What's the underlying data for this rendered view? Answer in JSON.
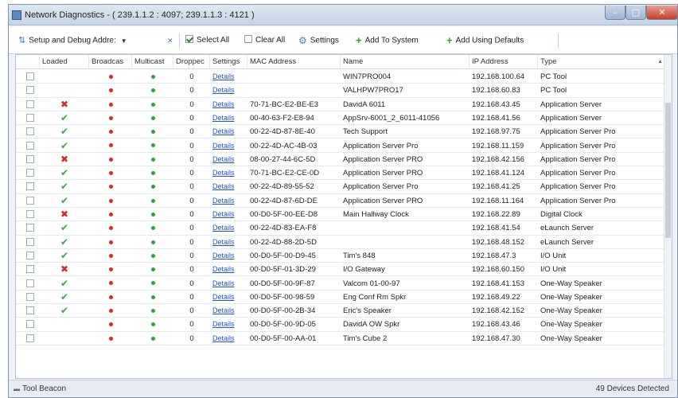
{
  "window": {
    "title": "Network Diagnostics - ( 239.1.1.2 : 4097; 239.1.1.3 : 4121 )",
    "minimize_glyph": "–",
    "maximize_glyph": "□",
    "close_glyph": "✕"
  },
  "toolbar": {
    "setup_label": "Setup and Debug Addre:",
    "select_all_label": "Select All",
    "clear_all_label": "Clear All",
    "settings_label": "Settings",
    "add_to_system_label": "Add To System",
    "add_using_defaults_label": "Add Using Defaults"
  },
  "columns": {
    "loaded": "Loaded",
    "broadcast": "Broadcas",
    "multicast": "Multicast",
    "dropped": "Droppec",
    "settings": "Settings",
    "mac": "MAC Address",
    "name": "Name",
    "ip": "IP Address",
    "type": "Type"
  },
  "colors": {
    "error": "#d22b2b",
    "ok": "#3aa83a",
    "broadcast_dot": "#e02828",
    "multicast_dot": "#29a832",
    "link": "#2255cc"
  },
  "rows": [
    {
      "loaded": "",
      "dropped": "0",
      "settings": "Details",
      "mac": "",
      "name": "WIN7PRO004",
      "ip": "192.168.100.64",
      "type": "PC Tool"
    },
    {
      "loaded": "",
      "dropped": "0",
      "settings": "Details",
      "mac": "",
      "name": "VALHPW7PRO17",
      "ip": "192.168.60.83",
      "type": "PC Tool"
    },
    {
      "loaded": "x",
      "dropped": "0",
      "settings": "Details",
      "mac": "70-71-BC-E2-BE-E3",
      "name": "DavidA 6011",
      "ip": "192.168.43.45",
      "type": "Application Server"
    },
    {
      "loaded": "ok",
      "dropped": "0",
      "settings": "Details",
      "mac": "00-40-63-F2-E8-94",
      "name": "AppSrv-6001_2_6011-41056",
      "ip": "192.168.41.56",
      "type": "Application Server"
    },
    {
      "loaded": "ok",
      "dropped": "0",
      "settings": "Details",
      "mac": "00-22-4D-87-8E-40",
      "name": "Tech Support",
      "ip": "192.168.97.75",
      "type": "Application Server Pro"
    },
    {
      "loaded": "ok",
      "dropped": "0",
      "settings": "Details",
      "mac": "00-22-4D-AC-4B-03",
      "name": "Application Server Pro",
      "ip": "192.168.11.159",
      "type": "Application Server Pro"
    },
    {
      "loaded": "x",
      "dropped": "0",
      "settings": "Details",
      "mac": "08-00-27-44-6C-5D",
      "name": "Application Server PRO",
      "ip": "192.168.42.156",
      "type": "Application Server Pro"
    },
    {
      "loaded": "ok",
      "dropped": "0",
      "settings": "Details",
      "mac": "70-71-BC-E2-CE-0D",
      "name": "Application Server PRO",
      "ip": "192.168.41.124",
      "type": "Application Server Pro"
    },
    {
      "loaded": "ok",
      "dropped": "0",
      "settings": "Details",
      "mac": "00-22-4D-89-55-52",
      "name": "Application Server Pro",
      "ip": "192.168.41.25",
      "type": "Application Server Pro"
    },
    {
      "loaded": "ok",
      "dropped": "0",
      "settings": "Details",
      "mac": "00-22-4D-87-6D-DE",
      "name": "Application Server PRO",
      "ip": "192.168.11.164",
      "type": "Application Server Pro"
    },
    {
      "loaded": "x",
      "dropped": "0",
      "settings": "Details",
      "mac": "00-D0-5F-00-EE-D8",
      "name": "Main Hallway Clock",
      "ip": "192.168.22.89",
      "type": "Digital Clock"
    },
    {
      "loaded": "ok",
      "dropped": "0",
      "settings": "Details",
      "mac": "00-22-4D-83-EA-F8",
      "name": "",
      "ip": "192.168.41.54",
      "type": "eLaunch Server"
    },
    {
      "loaded": "ok",
      "dropped": "0",
      "settings": "Details",
      "mac": "00-22-4D-88-2D-5D",
      "name": "",
      "ip": "192.168.48.152",
      "type": "eLaunch Server"
    },
    {
      "loaded": "ok",
      "dropped": "0",
      "settings": "Details",
      "mac": "00-D0-5F-00-D9-45",
      "name": "Tim's 848",
      "ip": "192.168.47.3",
      "type": "I/O Unit"
    },
    {
      "loaded": "x",
      "dropped": "0",
      "settings": "Details",
      "mac": "00-D0-5F-01-3D-29",
      "name": "I/O Gateway",
      "ip": "192.168.60.150",
      "type": "I/O Unit"
    },
    {
      "loaded": "ok",
      "dropped": "0",
      "settings": "Details",
      "mac": "00-D0-5F-00-9F-87",
      "name": "Valcom 01-00-97",
      "ip": "192.168.41.153",
      "type": "One-Way Speaker"
    },
    {
      "loaded": "ok",
      "dropped": "0",
      "settings": "Details",
      "mac": "00-D0-5F-00-98-59",
      "name": "Eng Conf Rm Spkr",
      "ip": "192.168.49.22",
      "type": "One-Way Speaker"
    },
    {
      "loaded": "ok",
      "dropped": "0",
      "settings": "Details",
      "mac": "00-D0-5F-00-2B-34",
      "name": "Eric's Speaker",
      "ip": "192.168.42.152",
      "type": "One-Way Speaker"
    },
    {
      "loaded": "",
      "dropped": "0",
      "settings": "Details",
      "mac": "00-D0-5F-00-9D-05",
      "name": "DavidA OW Spkr",
      "ip": "192.168.43.46",
      "type": "One-Way Speaker"
    },
    {
      "loaded": "",
      "dropped": "0",
      "settings": "Details",
      "mac": "00-D0-5F-00-AA-01",
      "name": "Tim's Cube 2",
      "ip": "192.168.47.30",
      "type": "One-Way Speaker"
    }
  ],
  "status": {
    "left_label": "Tool Beacon",
    "right_label": "49 Devices Detected"
  }
}
